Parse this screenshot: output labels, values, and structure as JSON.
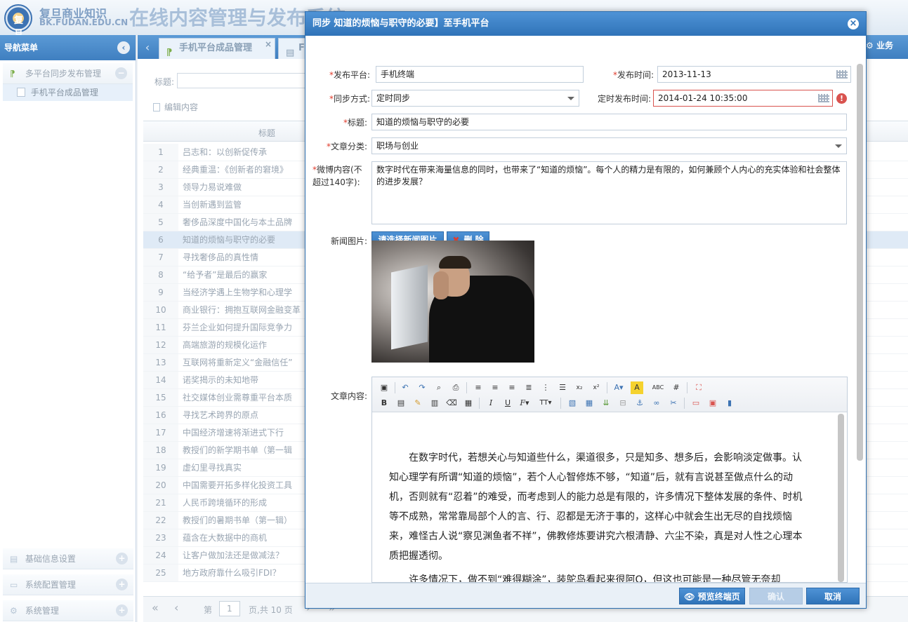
{
  "header": {
    "logo_text": "复旦",
    "org_name": "复旦商业知识",
    "org_site": "BK.FUDAN.EDU.CN",
    "system_title": "在线内容管理与发布系统"
  },
  "sidebar": {
    "title": "导航菜单",
    "groups_top": [
      {
        "label": "多平台同步发布管理",
        "toggle": "−"
      }
    ],
    "sub_items": [
      {
        "label": "手机平台成品管理"
      }
    ],
    "groups_bottom": [
      {
        "label": "基础信息设置",
        "toggle": "+"
      },
      {
        "label": "系统配置管理",
        "toggle": "+"
      },
      {
        "label": "系统管理",
        "toggle": "+"
      }
    ]
  },
  "tabs": [
    {
      "label": "手机平台成品管理"
    },
    {
      "label": "F"
    }
  ],
  "tab_right_label": "业务",
  "main": {
    "search_label": "标题:",
    "edit_label": "编辑内容",
    "column_title": "标题",
    "rows": [
      {
        "n": "1",
        "title": "吕志和：以创新促传承"
      },
      {
        "n": "2",
        "title": "经典重温：《创新者的窘境》"
      },
      {
        "n": "3",
        "title": "领导力易说难做"
      },
      {
        "n": "4",
        "title": "当创新遇到监管"
      },
      {
        "n": "5",
        "title": "奢侈品深度中国化与本土品牌"
      },
      {
        "n": "6",
        "title": "知道的烦恼与职守的必要"
      },
      {
        "n": "7",
        "title": "寻找奢侈品的真性情"
      },
      {
        "n": "8",
        "title": "“给予者”是最后的赢家"
      },
      {
        "n": "9",
        "title": "当经济学遇上生物学和心理学"
      },
      {
        "n": "10",
        "title": "商业银行：拥抱互联网金融变革"
      },
      {
        "n": "11",
        "title": "芬兰企业如何提升国际竞争力"
      },
      {
        "n": "12",
        "title": "高端旅游的规模化运作"
      },
      {
        "n": "13",
        "title": "互联网将重新定义“金融信任”"
      },
      {
        "n": "14",
        "title": "诺奖揭示的未知地带"
      },
      {
        "n": "15",
        "title": "社交媒体创业需尊重平台本质"
      },
      {
        "n": "16",
        "title": "寻找艺术跨界的原点"
      },
      {
        "n": "17",
        "title": "中国经济增速将渐进式下行"
      },
      {
        "n": "18",
        "title": "教授们的新学期书单（第一辑"
      },
      {
        "n": "19",
        "title": "虚幻里寻找真实"
      },
      {
        "n": "20",
        "title": "中国需要开拓多样化投资工具"
      },
      {
        "n": "21",
        "title": "人民币跨境循环的形成"
      },
      {
        "n": "22",
        "title": "教授们的暑期书单（第一辑）"
      },
      {
        "n": "23",
        "title": "蕴含在大数据中的商机"
      },
      {
        "n": "24",
        "title": "让客户做加法还是做减法？"
      },
      {
        "n": "25",
        "title": "地方政府靠什么吸引FDI？"
      }
    ],
    "selected_row": "6",
    "pager": {
      "first": "«",
      "prev": "‹",
      "page_label": "第",
      "page_value": "1",
      "total": "页,共 10 页",
      "next": "›",
      "last": "»"
    }
  },
  "modal": {
    "title": "同步 知道的烦恼与职守的必要】至手机平台",
    "close": "×",
    "platform_label": "发布平台:",
    "platform_value": "手机终端",
    "publish_time_label": "发布时间:",
    "publish_time_value": "2013-11-13",
    "sync_mode_label": "同步方式:",
    "sync_mode_value": "定时同步",
    "scheduled_time_label": "定时发布时间:",
    "scheduled_time_value": "2014-01-24 10:35:00",
    "error_mark": "!",
    "title_label": "标题:",
    "title_value": "知道的烦恼与职守的必要",
    "category_label": "文章分类:",
    "category_value": "职场与创业",
    "weibo_label_1": "微博内容(不",
    "weibo_label_2": "超过140字):",
    "weibo_value": "数字时代在带来海量信息的同时，也带来了“知道的烦恼”。每个人的精力是有限的，如何兼顾个人内心的充实体验和社会整体的进步发展？",
    "image_label": "新闻图片:",
    "choose_image_button": "请选择新闻图片",
    "delete_button": "删 除",
    "content_label": "文章内容:",
    "content_paragraphs": [
      "在数字时代，若想关心与知道些什么，渠道很多，只是知多、想多后，会影响淡定做事。认知心理学有所谓“知道的烦恼”，若个人心智修炼不够，“知道”后，就有言说甚至做点什么的动机，否则就有“忍着”的难受，而考虑到人的能力总是有限的，许多情况下整体发展的条件、时机等不成熟，常常靠局部个人的言、行、忍都是无济于事的，这样心中就会生出无尽的自找烦恼来，难怪古人说“察见渊鱼者不祥”，佛教修炼要讲究六根清静、六尘不染，真是对人性之心理本质把握透彻。",
      "许多情况下，做不到“难得糊涂”，装鸵鸟看起来很阿Q，但这也可能是一种尽管无奈却"
    ],
    "preview_button": "预览终端页",
    "confirm_button": "确认",
    "cancel_button": "取消"
  }
}
